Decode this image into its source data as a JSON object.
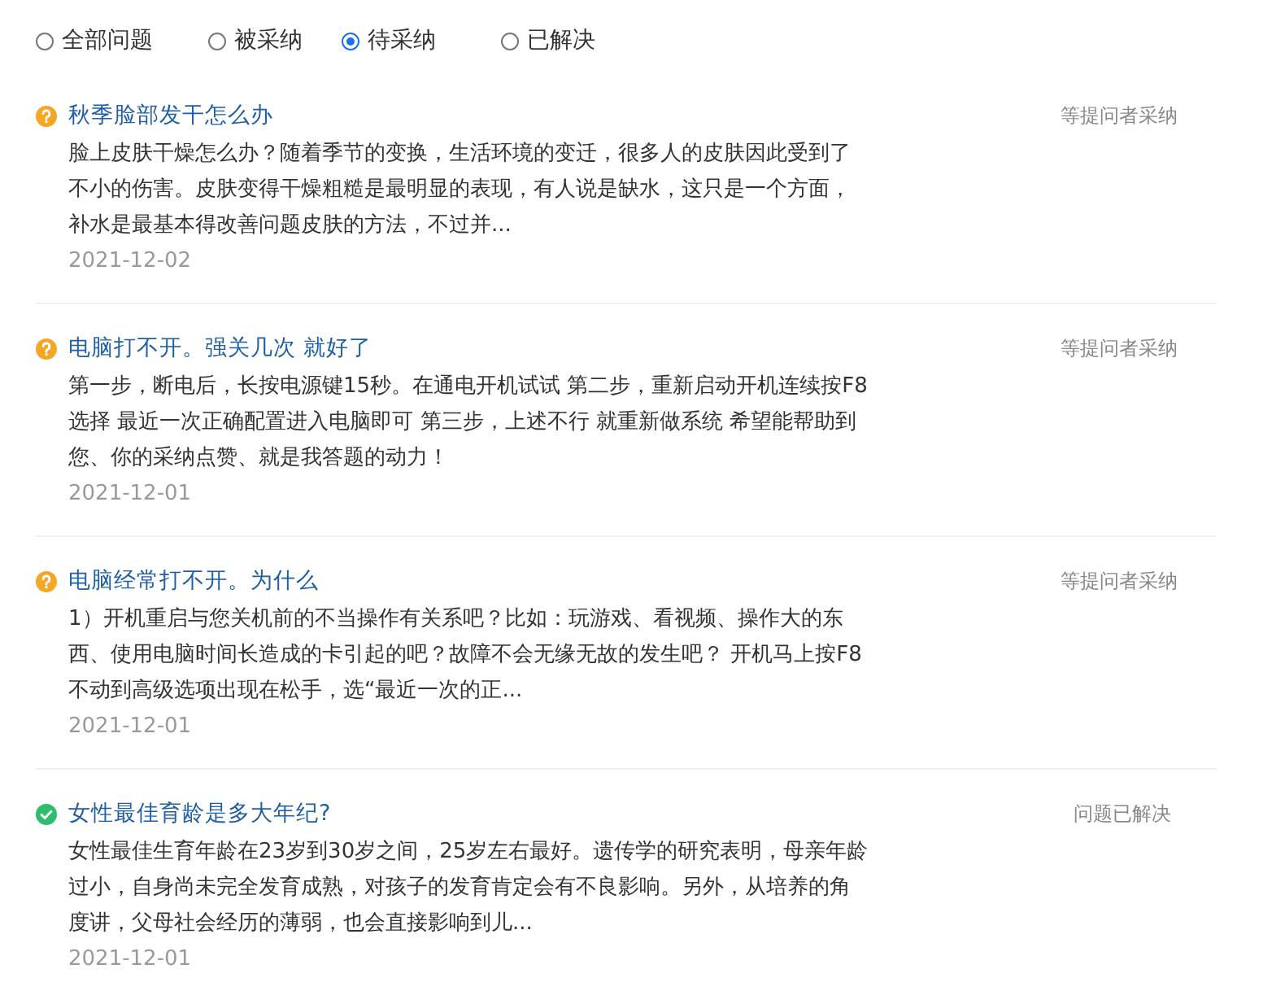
{
  "filters": [
    {
      "label": "全部问题",
      "selected": false
    },
    {
      "label": "被采纳",
      "selected": false
    },
    {
      "label": "待采纳",
      "selected": true
    },
    {
      "label": "已解决",
      "selected": false
    }
  ],
  "questions": [
    {
      "kind": "pending",
      "title": "秋季脸部发干怎么办",
      "status": "等提问者采纳",
      "body": [
        "脸上皮肤干燥怎么办？随着季节的变换，生活环境的变迁，很多人的皮肤因此受到了",
        "不小的伤害。皮肤变得干燥粗糙是最明显的表现，有人说是缺水，这只是一个方面，",
        "补水是最基本得改善问题皮肤的方法，不过并..."
      ],
      "date": "2021-12-02"
    },
    {
      "kind": "pending",
      "title": "电脑打不开。强关几次 就好了",
      "status": "等提问者采纳",
      "body": [
        "第一步，断电后，长按电源键15秒。在通电开机试试 第二步，重新启动开机连续按F8",
        "选择 最近一次正确配置进入电脑即可 第三步，上述不行 就重新做系统 希望能帮助到",
        "您、你的采纳点赞、就是我答题的动力！"
      ],
      "date": "2021-12-01"
    },
    {
      "kind": "pending",
      "title": "电脑经常打不开。为什么",
      "status": "等提问者采纳",
      "body": [
        "1）开机重启与您关机前的不当操作有关系吧？比如：玩游戏、看视频、操作大的东",
        "西、使用电脑时间长造成的卡引起的吧？故障不会无缘无故的发生吧？ 开机马上按F8",
        "不动到高级选项出现在松手，选“最近一次的正..."
      ],
      "date": "2021-12-01"
    },
    {
      "kind": "resolved",
      "title": "女性最佳育龄是多大年纪?",
      "status": "问题已解决",
      "body": [
        "女性最佳生育年龄在23岁到30岁之间，25岁左右最好。遗传学的研究表明，母亲年龄",
        "过小，自身尚未完全发育成熟，对孩子的发育肯定会有不良影响。另外，从培养的角",
        "度讲，父母社会经历的薄弱，也会直接影响到儿..."
      ],
      "date": "2021-12-01"
    }
  ]
}
